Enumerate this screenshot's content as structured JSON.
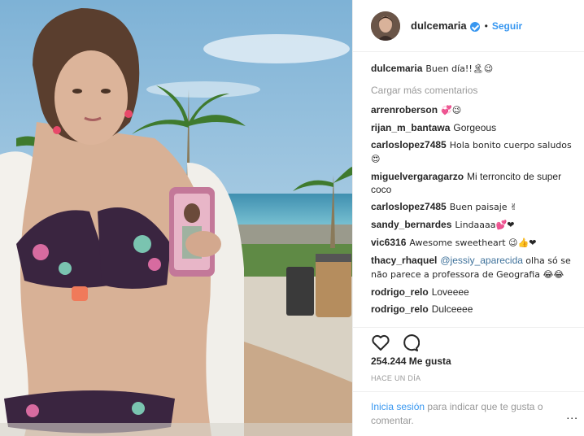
{
  "post": {
    "username": "dulcemaria",
    "follow_label": "Seguir",
    "separator": "•",
    "verified_icon": "verified-badge-icon",
    "accent_color": "#3897f0"
  },
  "caption": {
    "user": "dulcemaria",
    "text": "Buen día!!🏝😉"
  },
  "load_more": "Cargar más comentarios",
  "comments": [
    {
      "user": "arrenroberson",
      "text": "💞😉"
    },
    {
      "user": "rijan_m_bantawa",
      "text": "Gorgeous"
    },
    {
      "user": "carloslopez7485",
      "text": "Hola bonito cuerpo saludos 😍"
    },
    {
      "user": "miguelvergaragarzo",
      "text": "Mi terroncito de super coco"
    },
    {
      "user": "carloslopez7485",
      "text": "Buen paisaje ✌"
    },
    {
      "user": "sandy_bernardes",
      "text": "Lindaaaa💕❤"
    },
    {
      "user": "vic6316",
      "text": "Awesome sweetheart 😉👍❤"
    },
    {
      "user": "thacy_rhaquel",
      "mention": "@jessiy_aparecida",
      "text": "olha só se não parece a professora de Geografia 😂😂"
    },
    {
      "user": "rodrigo_relo",
      "text": "Loveeee"
    },
    {
      "user": "rodrigo_relo",
      "text": "Dulceeee"
    }
  ],
  "actions": {
    "like_icon": "heart-icon",
    "comment_icon": "comment-icon"
  },
  "likes": "254.244 Me gusta",
  "timestamp": "HACE UN DÍA",
  "footer": {
    "login_label": "Inicia sesión",
    "rest": "para indicar que te gusta o comentar.",
    "more_label": "..."
  }
}
